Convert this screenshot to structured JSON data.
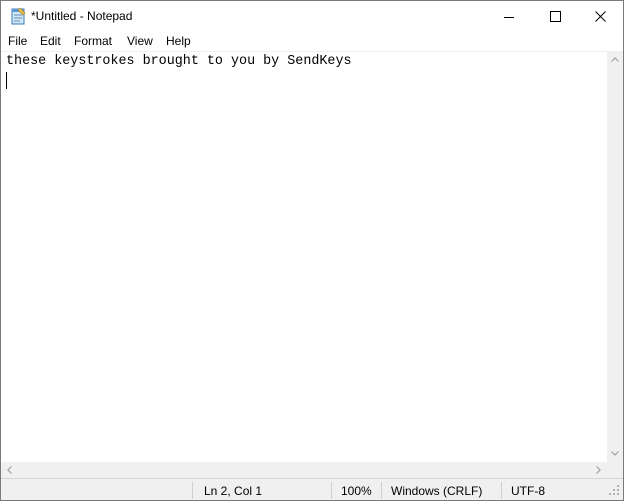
{
  "window": {
    "title": "*Untitled - Notepad",
    "icon": "notepad-icon"
  },
  "title_buttons": {
    "minimize": "minimize-icon",
    "maximize": "maximize-icon",
    "close": "close-icon"
  },
  "menu": {
    "file": "File",
    "edit": "Edit",
    "format": "Format",
    "view": "View",
    "help": "Help"
  },
  "editor": {
    "lines": [
      "these keystrokes brought to you by SendKeys",
      ""
    ]
  },
  "status": {
    "position": "Ln 2, Col 1",
    "zoom": "100%",
    "line_ending": "Windows (CRLF)",
    "encoding": "UTF-8"
  }
}
